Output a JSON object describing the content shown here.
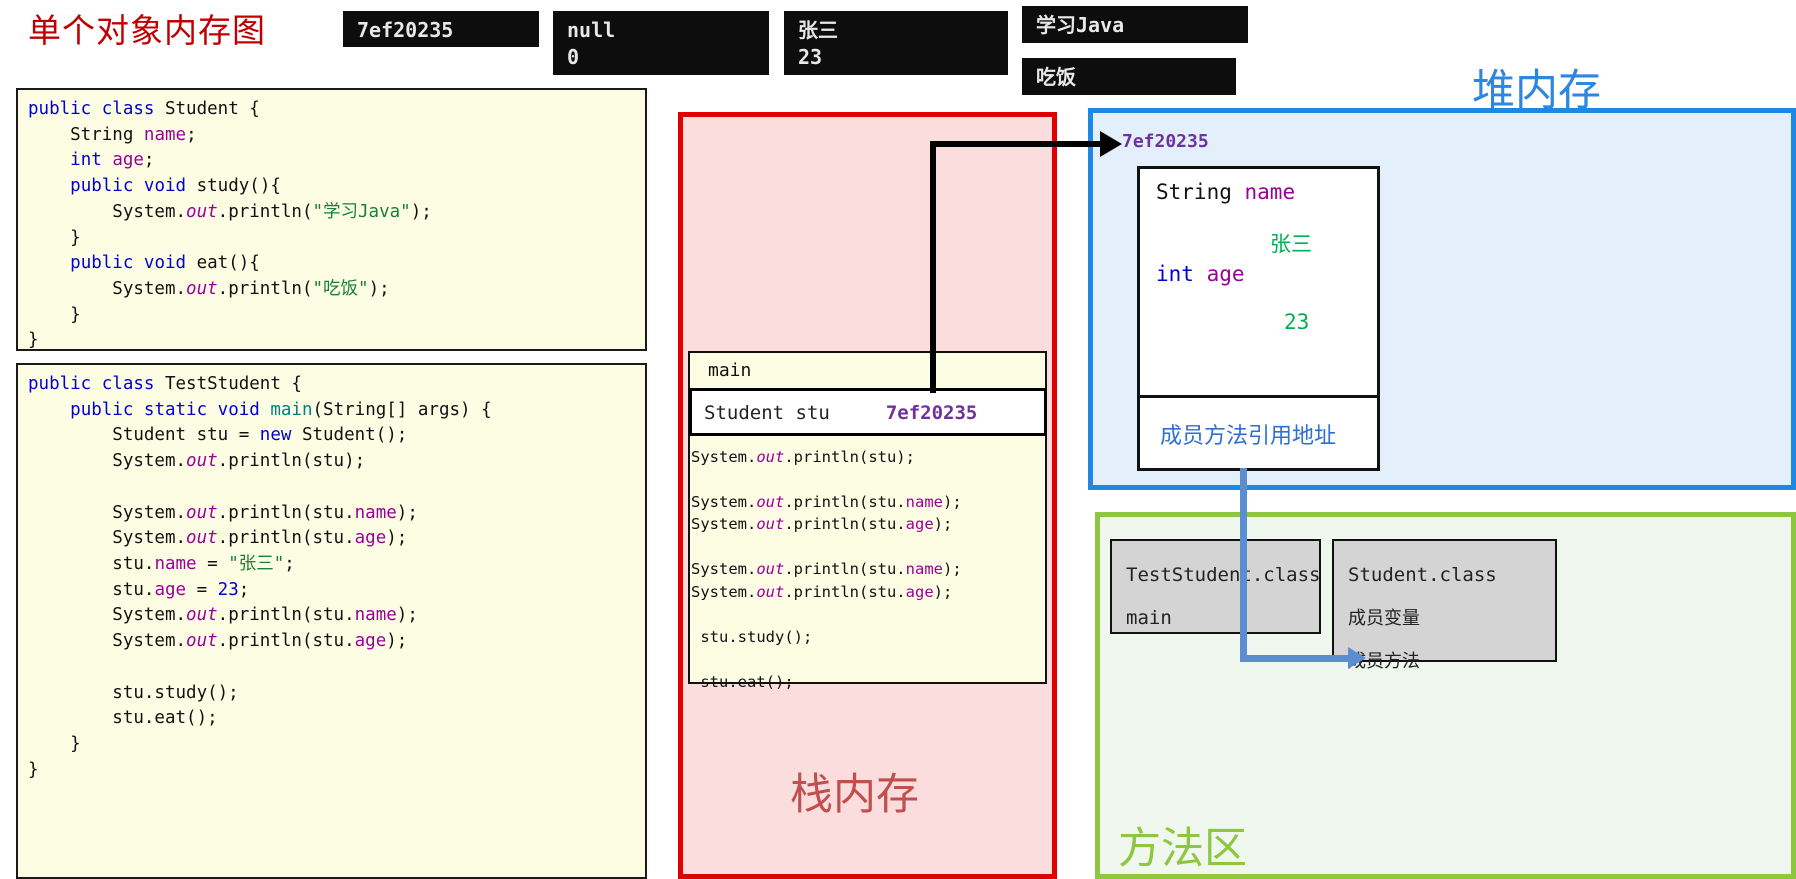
{
  "title": "单个对象内存图",
  "console_outputs": [
    {
      "id": "address",
      "lines": "7ef20235"
    },
    {
      "id": "null-zero",
      "lines": "null\n0"
    },
    {
      "id": "name-age",
      "lines": "张三\n23"
    },
    {
      "id": "study",
      "lines": "学习Java"
    },
    {
      "id": "eat",
      "lines": "吃饭"
    }
  ],
  "code_blocks": {
    "student_class": "public class Student {\n    String name;\n    int age;\n    public void study(){\n        System.out.println(\"学习Java\");\n    }\n    public void eat(){\n        System.out.println(\"吃饭\");\n    }\n}",
    "test_class": "public class TestStudent {\n    public static void main(String[] args) {\n        Student stu = new Student();\n        System.out.println(stu);\n\n        System.out.println(stu.name);\n        System.out.println(stu.age);\n        stu.name = \"张三\";\n        stu.age = 23;\n        System.out.println(stu.name);\n        System.out.println(stu.age);\n\n        stu.study();\n        stu.eat();\n    }\n}"
  },
  "stack": {
    "label": "栈内存",
    "frame_name": "main",
    "variable_type": "Student stu",
    "variable_value": "7ef20235",
    "frame_code": "System.out.println(stu);\n\nSystem.out.println(stu.name);\nSystem.out.println(stu.age);\n\nSystem.out.println(stu.name);\nSystem.out.println(stu.age);\n\n stu.study();\n\n stu.eat();",
    "border_color": "#E00000",
    "fill_color": "#FBDDDE"
  },
  "heap": {
    "label": "堆内存",
    "object_address": "7ef20235",
    "field_name_decl": "String name",
    "field_name_value": "张三",
    "field_age_decl": "int age",
    "field_age_value": "23",
    "method_ref": "成员方法引用地址",
    "border_color": "#1E88E5",
    "fill_color": "#E3EFFB"
  },
  "method_area": {
    "label": "方法区",
    "classes": [
      {
        "name": "TestStudent.class",
        "members": [
          "main"
        ]
      },
      {
        "name": "Student.class",
        "members": [
          "成员变量",
          "成员方法"
        ]
      }
    ],
    "border_color": "#8DC63F",
    "fill_color": "#F0F7EE"
  }
}
